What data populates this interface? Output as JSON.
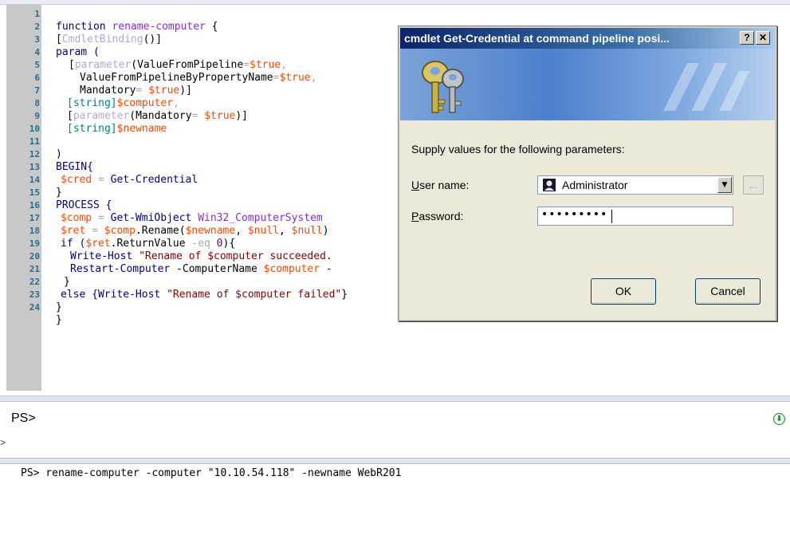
{
  "editor": {
    "lines": [
      {
        "n": "1"
      },
      {
        "n": "2"
      },
      {
        "n": "3"
      },
      {
        "n": "4"
      },
      {
        "n": "5"
      },
      {
        "n": "6"
      },
      {
        "n": "7"
      },
      {
        "n": "8"
      },
      {
        "n": "9"
      },
      {
        "n": "10"
      },
      {
        "n": "11"
      },
      {
        "n": "12"
      },
      {
        "n": "13"
      },
      {
        "n": "14"
      },
      {
        "n": "15"
      },
      {
        "n": "16"
      },
      {
        "n": "17"
      },
      {
        "n": "18"
      },
      {
        "n": "19"
      },
      {
        "n": "20"
      },
      {
        "n": "21"
      },
      {
        "n": "22"
      },
      {
        "n": "23"
      },
      {
        "n": "24"
      }
    ],
    "code": {
      "l1a": "function ",
      "l1b": "rename-computer",
      "l1c": " {",
      "l2a": "[",
      "l2b": "CmdletBinding",
      "l2c": "()]",
      "l3": "param (",
      "l4a": "[",
      "l4b": "parameter",
      "l4c": "(ValueFromPipeline",
      "l4d": "=",
      "l4e": "$true",
      "l4f": ",",
      "l5a": "ValueFromPipelineByPropertyName",
      "l5b": "=",
      "l5c": "$true",
      "l5d": ",",
      "l6a": "Mandatory",
      "l6b": "= ",
      "l6c": "$true",
      "l6d": ")]",
      "l7a": "[string]",
      "l7b": "$computer",
      "l7c": ",",
      "l8a": "[",
      "l8b": "parameter",
      "l8c": "(Mandatory",
      "l8d": "= ",
      "l8e": "$true",
      "l8f": ")]",
      "l9a": "[string]",
      "l9b": "$newname",
      "l11": ")",
      "l12": "BEGIN{",
      "l13a": "$cred",
      "l13b": " = ",
      "l13c": "Get-Credential",
      "l14": "}",
      "l15": "PROCESS {",
      "l16a": "$comp",
      "l16b": " = ",
      "l16c": "Get-WmiObject",
      "l16d": " Win32_ComputerSystem",
      "l17a": "$ret",
      "l17b": " = ",
      "l17c": "$comp",
      "l17d": ".Rename(",
      "l17e": "$newname",
      "l17f": ", ",
      "l17g": "$null",
      "l17h": ", ",
      "l17i": "$null",
      "l17j": ")",
      "l18a": "if (",
      "l18b": "$ret",
      "l18c": ".ReturnValue ",
      "l18d": "-eq",
      "l18e": " 0",
      "l18f": "){",
      "l19a": "Write-Host",
      "l19b": " \"Rename of $computer succeeded.",
      "l20a": "Restart-Computer",
      "l20b": " -ComputerName ",
      "l20c": "$computer",
      "l20d": " -",
      "l21": "}",
      "l22a": "else {",
      "l22b": "Write-Host",
      "l22c": " \"Rename of $computer failed\"",
      "l22d": "}",
      "l23": "}",
      "l24": "}"
    }
  },
  "command_pane": {
    "prompt": "PS>",
    "caret": ">"
  },
  "output_pane": {
    "line": "PS> rename-computer -computer \"10.10.54.118\" -newname WebR201"
  },
  "dialog": {
    "title": "cmdlet Get-Credential at command pipeline posi...",
    "help_label": "?",
    "close_label": "✕",
    "prompt": "Supply values for the following parameters:",
    "user_label_u": "U",
    "user_label_rest": "ser name:",
    "user_value": "Administrator",
    "browse_label": "...",
    "password_label_u": "P",
    "password_label_rest": "assword:",
    "password_masked": "•••••••••",
    "ok_label": "OK",
    "cancel_label": "Cancel"
  }
}
